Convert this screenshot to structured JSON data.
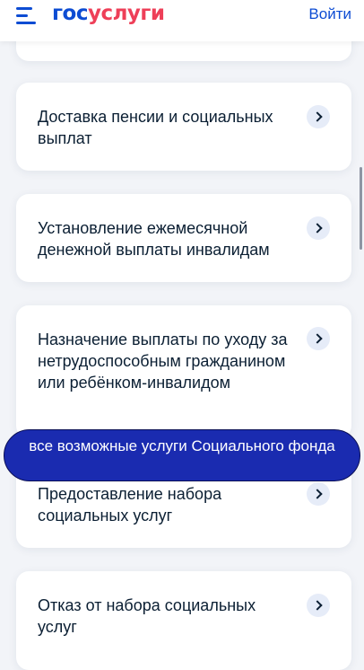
{
  "header": {
    "logo_part1": "гос",
    "logo_part2": "услуги",
    "login_label": "Войти"
  },
  "services": [
    {
      "title": "Доставка пенсии и социальных выплат"
    },
    {
      "title": "Установление ежемесячной денежной выплаты инвалидам"
    },
    {
      "title": "Назначение выплаты по уходу за нетрудоспособным гражданином или ребёнком-инвалидом"
    },
    {
      "title": "Предоставление набора социальных услуг"
    },
    {
      "title": "Отказ от набора социальных услуг"
    }
  ],
  "caption": {
    "text": "все возможные услуги Социального фонда"
  },
  "colors": {
    "brand_blue": "#0d4cd3",
    "brand_red": "#ee3f58",
    "caption_bg": "#1a2bb0",
    "page_bg": "#f2f4f8"
  },
  "icons": {
    "menu": "burger-menu-icon",
    "chevron": "chevron-right-icon"
  }
}
